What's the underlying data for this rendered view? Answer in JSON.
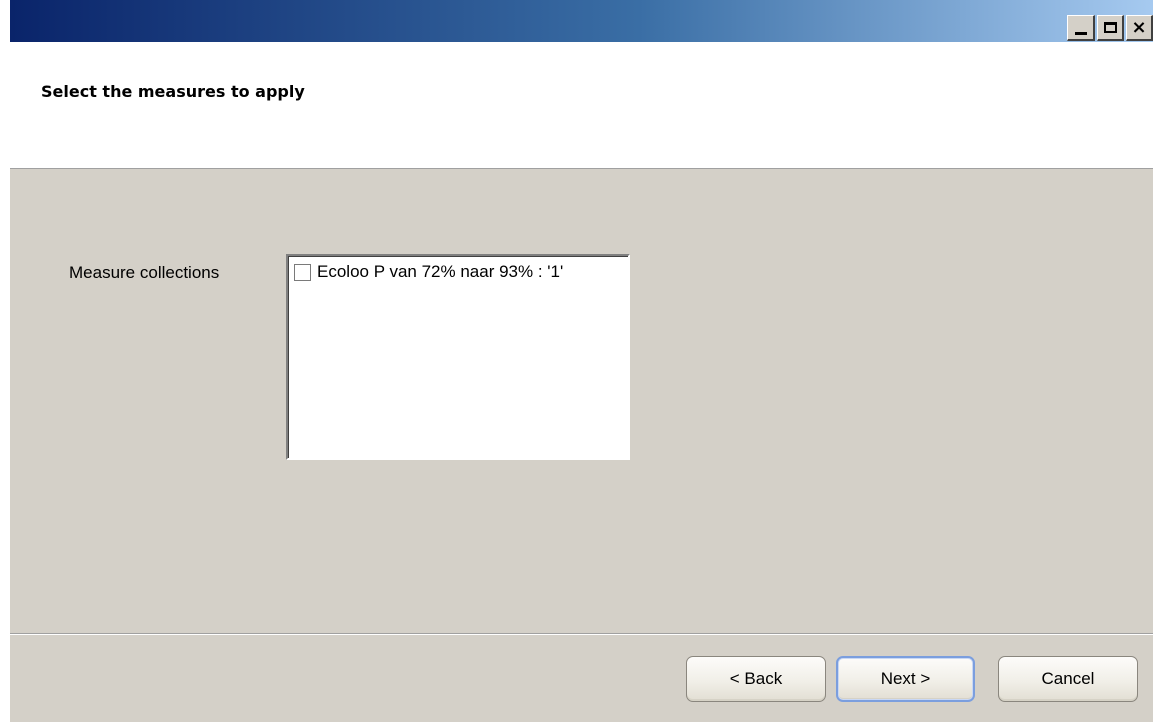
{
  "window": {
    "controls": {
      "minimize": "minimize",
      "maximize": "maximize",
      "close": "×"
    }
  },
  "header": {
    "title": "Select the measures to apply"
  },
  "form": {
    "measure_collections_label": "Measure collections",
    "items": [
      {
        "label": "Ecoloo P van 72% naar 93% : '1'",
        "checked": false
      }
    ]
  },
  "footer": {
    "back_label": "< Back",
    "next_label": "Next >",
    "cancel_label": "Cancel"
  },
  "colors": {
    "titlebar_start": "#0a246a",
    "titlebar_end": "#a6caf0",
    "dialog_background": "#d4d0c8",
    "default_button_border": "#7b9ede"
  }
}
